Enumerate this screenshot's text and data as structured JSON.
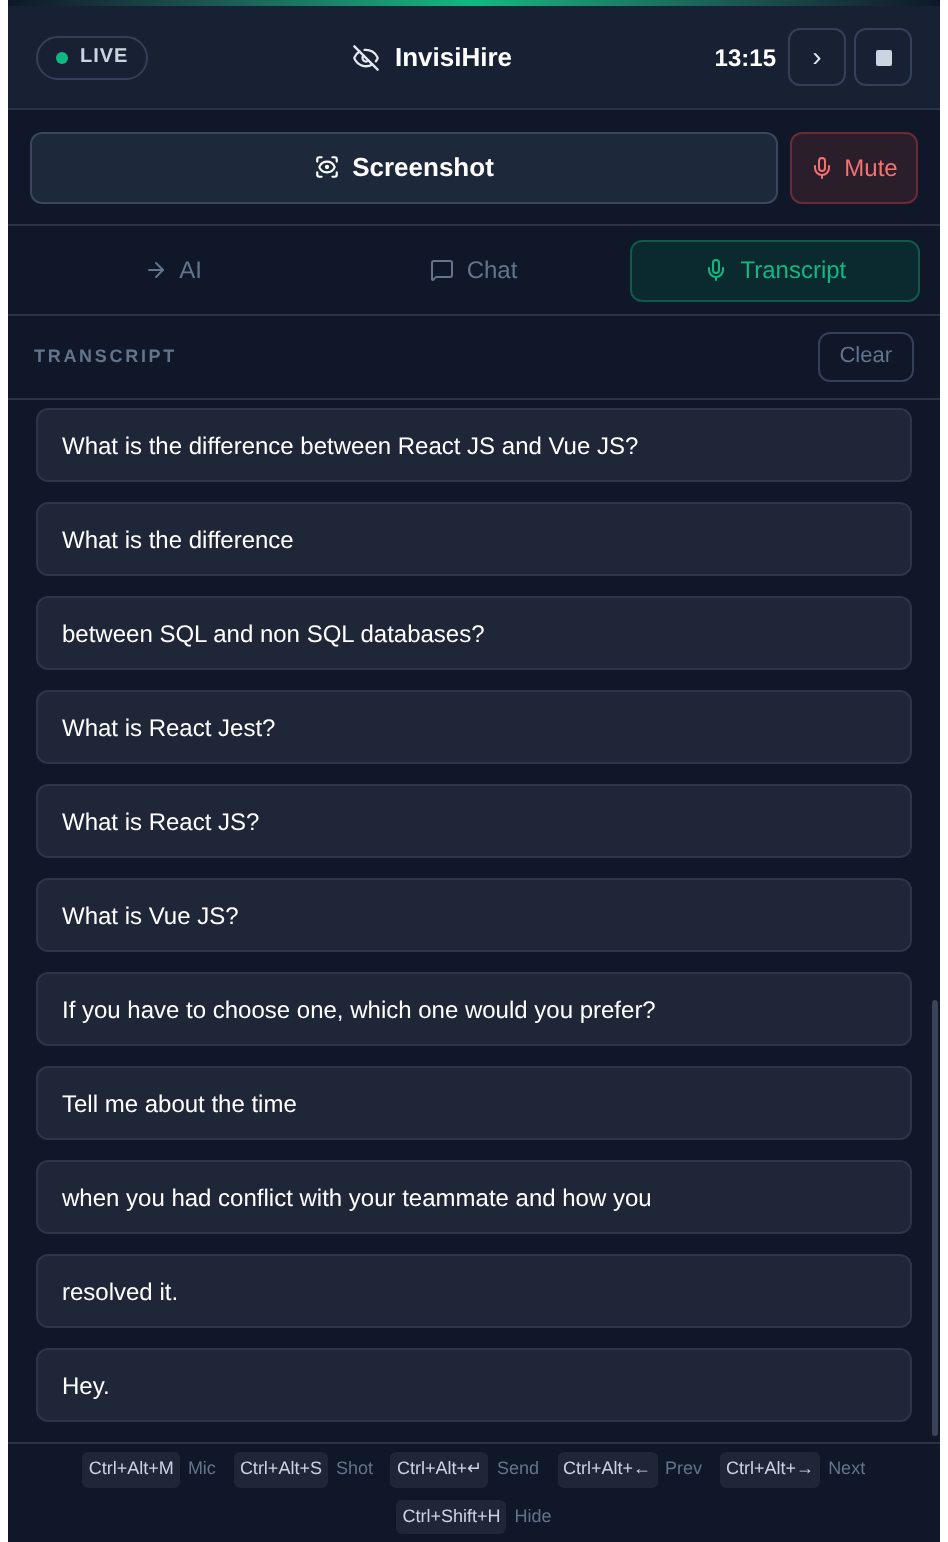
{
  "header": {
    "status": "LIVE",
    "title": "InvisiHire",
    "time": "13:15",
    "next_symbol": "›"
  },
  "actions": {
    "screenshot": "Screenshot",
    "mute": "Mute"
  },
  "tabs": [
    {
      "label": "AI",
      "kind": "arrow",
      "selected": false
    },
    {
      "label": "Chat",
      "kind": "chat",
      "selected": false
    },
    {
      "label": "Transcript",
      "kind": "mic",
      "selected": true
    }
  ],
  "transcript": {
    "heading": "TRANSCRIPT",
    "clear": "Clear",
    "items": [
      "What is the difference between React JS and Vue JS?",
      "What is the difference",
      "between SQL and non SQL databases?",
      "What is React Jest?",
      "What is React JS?",
      "What is Vue JS?",
      "If you have to choose one, which one would you prefer?",
      "Tell me about the time",
      "when you had conflict with your teammate and how you",
      "resolved it.",
      "Hey."
    ]
  },
  "shortcuts": [
    {
      "keys": "Ctrl+Alt+M",
      "label": "Mic"
    },
    {
      "keys": "Ctrl+Alt+S",
      "label": "Shot"
    },
    {
      "keys": "Ctrl+Alt+↵",
      "label": "Send"
    },
    {
      "keys": "Ctrl+Alt+←",
      "label": "Prev"
    },
    {
      "keys": "Ctrl+Alt+→",
      "label": "Next"
    },
    {
      "keys": "Ctrl+Shift+H",
      "label": "Hide"
    }
  ]
}
